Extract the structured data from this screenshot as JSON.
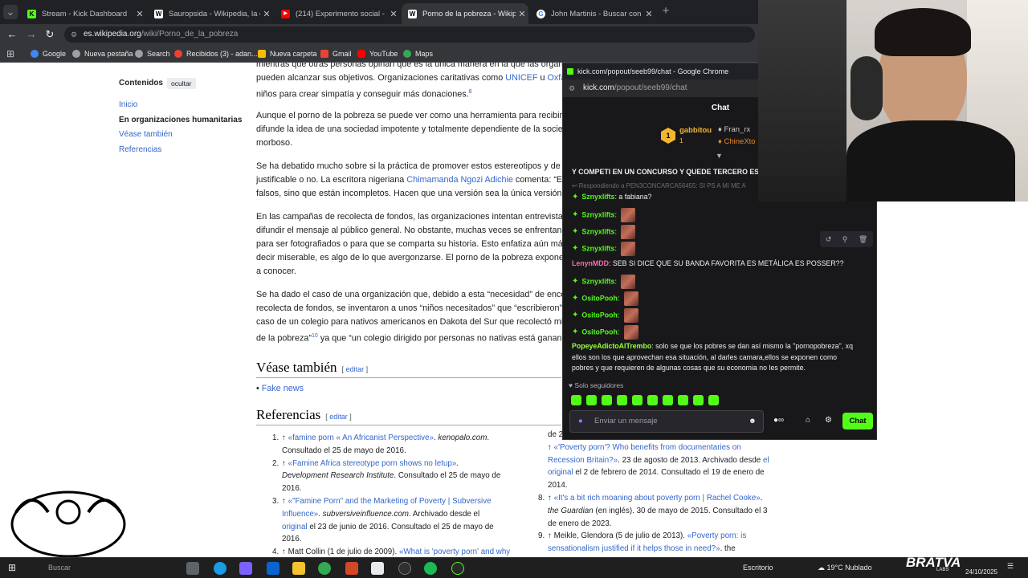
{
  "tabs": [
    {
      "title": "Stream - Kick Dashboard",
      "color": "#53fc18",
      "letter": "K"
    },
    {
      "title": "Sauropsida - Wikipedia, la enc",
      "color": "#ffffff",
      "letter": "W"
    },
    {
      "title": "(214) Experimento social - Con",
      "color": "#ff0000",
      "letter": "▶"
    },
    {
      "title": "Porno de la pobreza - Wikipedia",
      "color": "#ffffff",
      "letter": "W"
    },
    {
      "title": "John Martinis - Buscar con Goo",
      "color": "#4285f4",
      "letter": "G"
    }
  ],
  "urlbar": {
    "host": "es.wikipedia.org",
    "path": "/wiki/Porno_de_la_pobreza"
  },
  "bookmarks": [
    {
      "label": "Google",
      "color": "#4285f4"
    },
    {
      "label": "Nueva pestaña",
      "color": "#9aa0a6"
    },
    {
      "label": "Search",
      "color": "#9aa0a6"
    },
    {
      "label": "Recibidos (3) - adan...",
      "color": "#ea4335"
    },
    {
      "label": "Nueva carpeta",
      "color": "#fbbc04"
    },
    {
      "label": "Gmail",
      "color": "#ea4335"
    },
    {
      "label": "YouTube",
      "color": "#ff0000"
    },
    {
      "label": "Maps",
      "color": "#34a853"
    }
  ],
  "toc": {
    "heading": "Contenidos",
    "hide_label": "ocultar",
    "items": [
      "Inicio",
      "En organizaciones humanitarias",
      "Véase también",
      "Referencias"
    ]
  },
  "article": {
    "p1": [
      "mientras que otras personas opinan que es la única manera en la que las organi",
      "pueden alcanzar sus objetivos. Organizaciones caritativas como ",
      "UNICEF",
      " u ",
      "Oxfa",
      "niños para crear simpatía y conseguir más donaciones.",
      "8"
    ],
    "p2": [
      "Aunque el porno de la pobreza se puede ver como una herramienta para recibir n",
      "difunde la idea de una sociedad impotente y totalmente dependiente de la socied",
      "morboso."
    ],
    "p3": [
      "Se ha debatido mucho sobre si la práctica de promover estos estereotipos y de u",
      "justificable o no. La escritora nigeriana ",
      "Chimamanda Ngozi Adichie",
      " comenta: “El",
      "falsos, sino que están incompletos. Hacen que una versión sea la única versión”."
    ],
    "p4": [
      "En las campañas de recolecta de fondos, las organizaciones intentan entrevistar",
      "difundir el mensaje al público general. No obstante, muchas veces se enfrentan a",
      "para ser fotografiados o para que se comparta su historia. Esto enfatiza aún más",
      "decir miserable, es algo de lo que avergonzarse. El porno de la pobreza expone",
      "a conocer."
    ],
    "p5": [
      "Se ha dado el caso de una organización que, debido a esta “necesidad” de enco",
      "recolecta de fondos, se inventaron a unos “niños necesitados” que “escribieron”",
      "caso de un colegio para nativos americanos en Dakota del Sur que recolectó mill",
      "de la pobreza”",
      "10",
      "  ya que “un colegio dirigido por personas no nativas está ganan"
    ],
    "see_also": {
      "heading": "Véase también",
      "edit": "editar",
      "items": [
        "Fake news"
      ]
    },
    "references": {
      "heading": "Referencias",
      "edit": "editar"
    }
  },
  "refs_left": [
    [
      "1.",
      "↑ ",
      "«famine porn « An Africanist Perspective»",
      ". ",
      "kenopalo.com",
      "."
    ],
    [
      "",
      "",
      "Consultado el 25 de mayo de 2016.",
      "",
      "",
      ""
    ],
    [
      "2.",
      "↑ ",
      "«Famine Africa stereotype porn shows no letup»",
      ".",
      "",
      ""
    ],
    [
      "",
      "",
      "Development Research Institute",
      ". Consultado el 25 de mayo de",
      "",
      ""
    ],
    [
      "",
      "",
      "2016.",
      "",
      "",
      ""
    ],
    [
      "3.",
      "↑ ",
      "«\"Famine Porn\" and the Marketing of Poverty | Subversive",
      "",
      "",
      ""
    ],
    [
      "",
      "",
      "Influence»",
      ". ",
      "subversiveinfluence.com",
      ". Archivado desde el"
    ],
    [
      "",
      "",
      "original",
      " el 23 de junio de 2016. Consultado el 25 de mayo de",
      "",
      ""
    ],
    [
      "",
      "",
      "2016.",
      "",
      "",
      ""
    ],
    [
      "4.",
      "↑ ",
      "Matt Collin (1 de julio de 2009). ",
      "«What is 'poverty porn' and why",
      "",
      ""
    ]
  ],
  "refs_right": [
    [
      "",
      "",
      "de 2016.",
      "",
      "",
      ""
    ],
    [
      "",
      "",
      "↑ ",
      "«'Poverty porn'? Who benefits from documentaries on",
      "",
      ""
    ],
    [
      "",
      "",
      "Recession Britain?»",
      ". 23 de agosto de 2013. Archivado desde ",
      "el",
      ""
    ],
    [
      "",
      "",
      "original",
      " el 2 de febrero de 2014. Consultado el 19 de enero de",
      "",
      ""
    ],
    [
      "",
      "",
      "2014.",
      "",
      "",
      ""
    ],
    [
      "8.",
      "↑ ",
      "«It's a bit rich moaning about poverty porn | Rachel Cooke»",
      ".",
      "",
      ""
    ],
    [
      "",
      "",
      "the Guardian",
      " (en inglés). 30 de mayo de 2015. Consultado el 3",
      "",
      ""
    ],
    [
      "",
      "",
      "de enero de 2023.",
      "",
      "",
      ""
    ],
    [
      "9.",
      "↑ ",
      "Meikle, Glendora (5 de julio de 2013). ",
      "«Poverty porn: is",
      "",
      ""
    ],
    [
      "",
      "",
      "sensationalism justified if it helps those in need?»",
      ". the",
      "",
      ""
    ]
  ],
  "chat": {
    "window_title": "kick.com/popout/seeb99/chat - Google Chrome",
    "url_host": "kick.com",
    "url_path": "/popout/seeb99/chat",
    "header": "Chat",
    "leaderboard": {
      "user": "gabbitou",
      "count": "1",
      "second": "Fran_rx",
      "third": "ChineXto"
    },
    "pinned": "Y COMPETI EN UN CONCURSO Y QUEDE TERCERO EST",
    "reply": "Respondiendo a PEN3CONCARCA56455: SI PS A MI ME A",
    "messages": [
      {
        "user": "Sznyxlifts",
        "color": "#53fc18",
        "text": "a fabiana?",
        "emote": false,
        "badge": true
      },
      {
        "user": "Sznyxlifts",
        "color": "#53fc18",
        "text": "",
        "emote": true,
        "badge": true
      },
      {
        "user": "Sznyxlifts",
        "color": "#53fc18",
        "text": "",
        "emote": true,
        "badge": true
      },
      {
        "user": "Sznyxlifts",
        "color": "#53fc18",
        "text": "",
        "emote": true,
        "badge": true
      },
      {
        "user": "LenynMDD",
        "color": "#ff6ba8",
        "text": "SEB SI DICE QUE SU BANDA FAVORITA ES METÁLICA ES POSSER??",
        "emote": false,
        "badge": false
      },
      {
        "user": "Sznyxlifts",
        "color": "#53fc18",
        "text": "",
        "emote": true,
        "badge": true
      },
      {
        "user": "OsitoPooh",
        "color": "#53fc18",
        "text": "",
        "emote": true,
        "badge": true
      },
      {
        "user": "OsitoPooh",
        "color": "#53fc18",
        "text": "",
        "emote": true,
        "badge": true
      },
      {
        "user": "OsitoPooh",
        "color": "#53fc18",
        "text": "",
        "emote": true,
        "badge": true
      }
    ],
    "long_message": {
      "user": "PopeyeAdictoAlTrembo",
      "color": "#9bff3d",
      "lines": [
        "solo se que los pobres se dan así mismo la \"pornopobreza\", xq",
        "ellos son los que aprovechan esa situación, al darles camara,ellos se exponen como",
        "pobres y que requieren de algunas cosas que su economia no les permite."
      ]
    },
    "followers_only": "Solo seguidores",
    "input_placeholder": "Enviar un mensaje",
    "send_label": "Chat"
  },
  "taskbar": {
    "search": "Buscar",
    "desktop": "Escritorio",
    "weather": "19°C  Nublado",
    "date": "24/10/2025",
    "brand": "BRATVA",
    "brand_sub": "LABS"
  }
}
